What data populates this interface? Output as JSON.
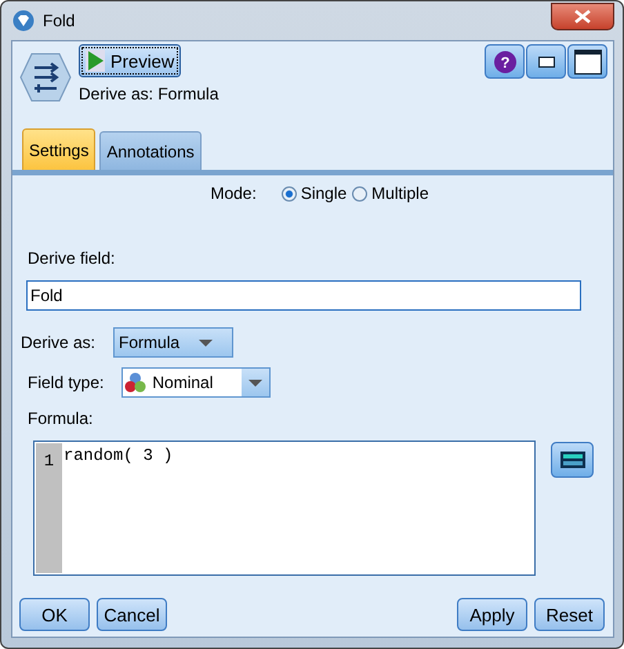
{
  "window": {
    "title": "Fold"
  },
  "header": {
    "preview_button": "Preview",
    "subtitle": "Derive as: Formula",
    "help_glyph": "?"
  },
  "tabs": [
    {
      "label": "Settings",
      "selected": true
    },
    {
      "label": "Annotations",
      "selected": false
    }
  ],
  "mode": {
    "label": "Mode:",
    "options": [
      {
        "label": "Single",
        "selected": true
      },
      {
        "label": "Multiple",
        "selected": false
      }
    ]
  },
  "derive_field": {
    "label": "Derive field:",
    "value": "Fold"
  },
  "derive_as": {
    "label": "Derive as:",
    "value": "Formula"
  },
  "field_type": {
    "label": "Field type:",
    "value": "Nominal"
  },
  "formula": {
    "label": "Formula:",
    "lines": [
      {
        "number": "1",
        "text": "random( 3 )"
      }
    ]
  },
  "buttons": {
    "left": [
      "OK",
      "Cancel"
    ],
    "right": [
      "Apply",
      "Reset"
    ]
  }
}
